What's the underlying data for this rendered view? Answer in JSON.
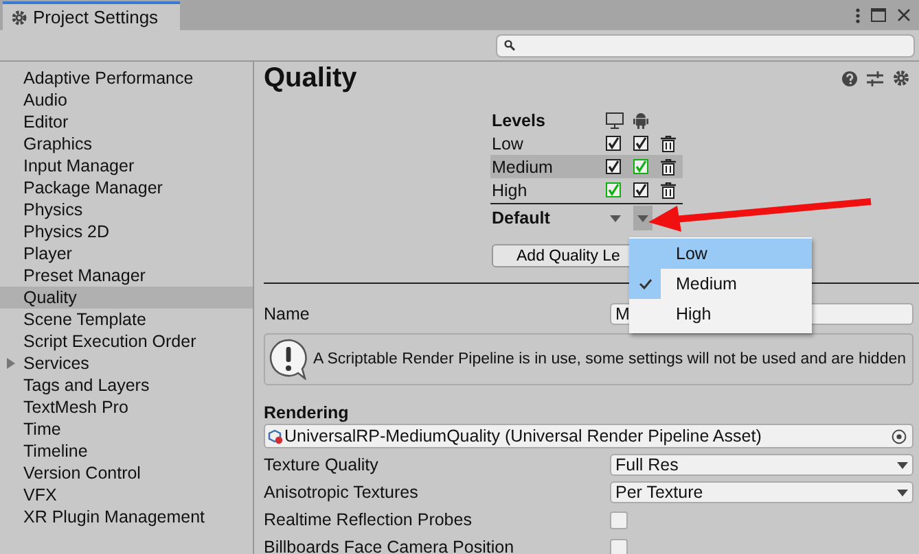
{
  "window": {
    "title": "Project Settings"
  },
  "sidebar": {
    "items": [
      {
        "label": "Adaptive Performance",
        "selected": false
      },
      {
        "label": "Audio",
        "selected": false
      },
      {
        "label": "Editor",
        "selected": false
      },
      {
        "label": "Graphics",
        "selected": false
      },
      {
        "label": "Input Manager",
        "selected": false
      },
      {
        "label": "Package Manager",
        "selected": false
      },
      {
        "label": "Physics",
        "selected": false
      },
      {
        "label": "Physics 2D",
        "selected": false
      },
      {
        "label": "Player",
        "selected": false
      },
      {
        "label": "Preset Manager",
        "selected": false
      },
      {
        "label": "Quality",
        "selected": true
      },
      {
        "label": "Scene Template",
        "selected": false
      },
      {
        "label": "Script Execution Order",
        "selected": false
      },
      {
        "label": "Services",
        "selected": false,
        "expanded": false
      },
      {
        "label": "Tags and Layers",
        "selected": false
      },
      {
        "label": "TextMesh Pro",
        "selected": false
      },
      {
        "label": "Time",
        "selected": false
      },
      {
        "label": "Timeline",
        "selected": false
      },
      {
        "label": "Version Control",
        "selected": false
      },
      {
        "label": "VFX",
        "selected": false
      },
      {
        "label": "XR Plugin Management",
        "selected": false
      }
    ]
  },
  "page": {
    "title": "Quality",
    "levels": {
      "heading": "Levels",
      "rows": [
        {
          "name": "Low",
          "selected": false,
          "platforms": [
            {
              "checked": true,
              "default": false
            },
            {
              "checked": true,
              "default": false
            }
          ]
        },
        {
          "name": "Medium",
          "selected": true,
          "platforms": [
            {
              "checked": true,
              "default": false
            },
            {
              "checked": true,
              "default": true
            }
          ]
        },
        {
          "name": "High",
          "selected": false,
          "platforms": [
            {
              "checked": true,
              "default": true
            },
            {
              "checked": true,
              "default": false
            }
          ]
        }
      ]
    },
    "default_label": "Default",
    "default_dropdowns": [
      {
        "open": false
      },
      {
        "open": true
      }
    ],
    "add_button": "Add Quality Le",
    "name": {
      "label": "Name",
      "value": "M"
    },
    "help_text": "A Scriptable Render Pipeline is in use, some settings will not be used and are hidden",
    "section": "Rendering",
    "pipeline_asset": "UniversalRP-MediumQuality (Universal Render Pipeline Asset)",
    "settings": [
      {
        "kind": "dropdown",
        "label": "Texture Quality",
        "value": "Full Res"
      },
      {
        "kind": "dropdown",
        "label": "Anisotropic Textures",
        "value": "Per Texture"
      },
      {
        "kind": "checkbox",
        "label": "Realtime Reflection Probes",
        "checked": false
      },
      {
        "kind": "checkbox",
        "label": "Billboards Face Camera Position",
        "checked": false
      }
    ]
  },
  "popup": {
    "items": [
      {
        "label": "Low",
        "highlighted": true,
        "checked": false
      },
      {
        "label": "Medium",
        "highlighted": false,
        "checked": true
      },
      {
        "label": "High",
        "highlighted": false,
        "checked": false
      }
    ]
  }
}
